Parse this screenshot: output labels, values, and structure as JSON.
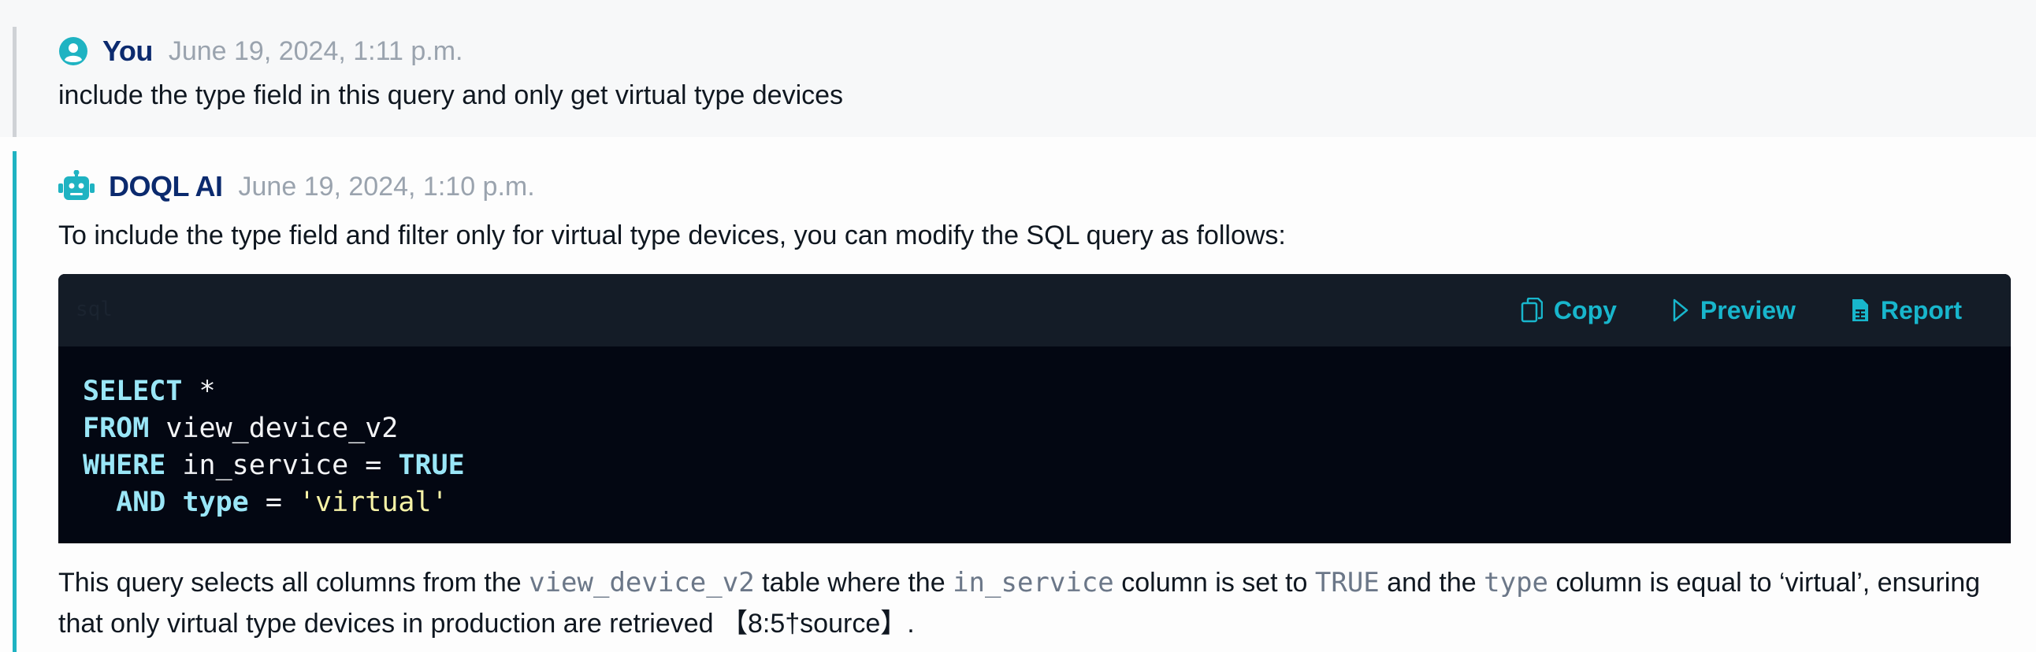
{
  "user_message": {
    "author": "You",
    "timestamp": "June 19, 2024, 1:11 p.m.",
    "text": "include the type field in this query and only get virtual type devices"
  },
  "ai_message": {
    "author": "DOQL AI",
    "timestamp": "June 19, 2024, 1:10 p.m.",
    "intro": "To include the type field and filter only for virtual type devices, you can modify the SQL query as follows:",
    "code": {
      "language": "sql",
      "actions": {
        "copy": "Copy",
        "preview": "Preview",
        "report": "Report"
      },
      "lines": {
        "l1_kw": "SELECT",
        "l1_rest": " *",
        "l2_kw": "FROM",
        "l2_rest": " view_device_v2",
        "l3_kw": "WHERE",
        "l3_mid": " in_service = ",
        "l3_kw2": "TRUE",
        "l4_indent": "  ",
        "l4_kw": "AND",
        "l4_sp": " ",
        "l4_kw2": "type",
        "l4_mid": " = ",
        "l4_str": "'virtual'"
      }
    },
    "explanation": {
      "p1": "This query selects all columns from the ",
      "c1": "view_device_v2",
      "p2": " table where the ",
      "c2": "in_service",
      "p3": " column is set to ",
      "c3": "TRUE",
      "p4": " and the ",
      "c4": "type",
      "p5": " column is equal to ‘virtual’, ensuring that only virtual type devices in production are retrieved 【8:5†source】."
    }
  },
  "colors": {
    "accent": "#1fb3c2",
    "author": "#0b2a6e",
    "code_bg": "#030712",
    "code_header_bg": "#141c27",
    "action": "#18b6cc"
  },
  "icons": {
    "user_avatar": "user-circle-icon",
    "ai_avatar": "robot-icon",
    "copy": "copy-icon",
    "preview": "play-icon",
    "report": "report-icon"
  }
}
